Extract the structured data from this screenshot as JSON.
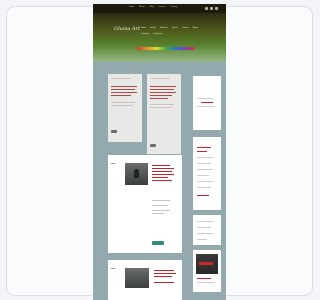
{
  "site": {
    "logo_text": "Ghana Art",
    "top_nav": [
      "Home",
      "About",
      "Blog",
      "Contact",
      "Privacy"
    ],
    "main_nav": [
      "Home",
      "Artists",
      "Galleries",
      "Events",
      "Contact",
      "About"
    ],
    "sub_nav": [
      "Paintings",
      "Sculpture"
    ]
  },
  "colors": {
    "header_dark": "#2d2a12",
    "header_green": "#57822c",
    "page_bg": "#93a9ae",
    "post_title_red": "#c4232b",
    "button_teal": "#2d8c7c"
  },
  "icons": [
    "facebook-icon",
    "twitter-icon",
    "rss-icon"
  ]
}
